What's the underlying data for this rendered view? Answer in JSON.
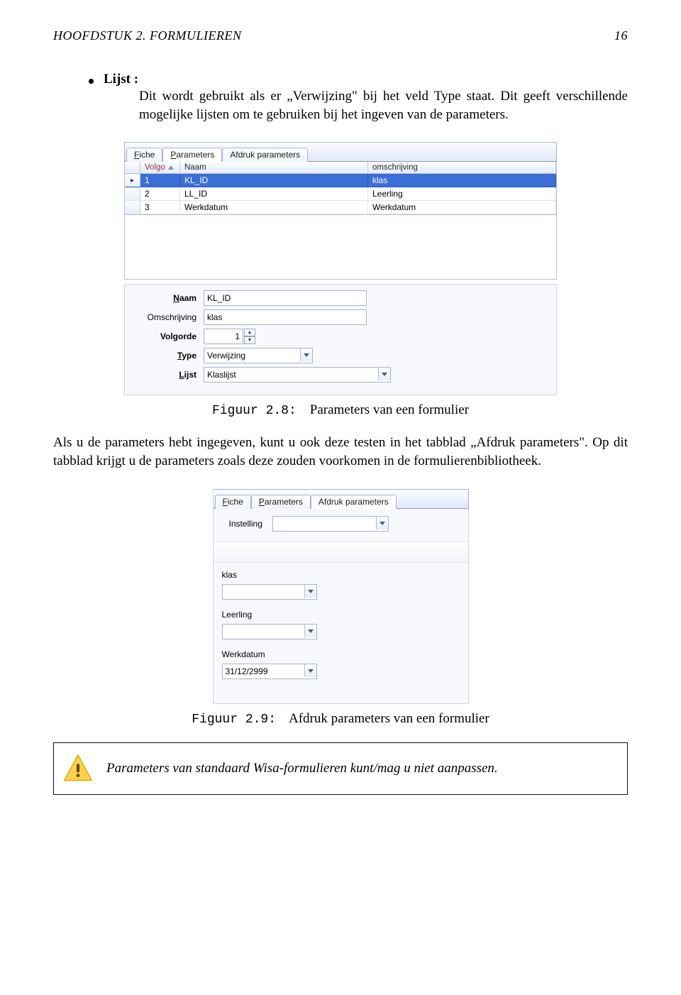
{
  "header": {
    "left": "HOOFDSTUK 2.  FORMULIEREN",
    "right": "16"
  },
  "bullet": {
    "label": "Lijst :",
    "body": "Dit wordt gebruikt als er „Verwijzing\" bij het veld Type staat. Dit geeft verschillende mogelijke lijsten om te gebruiken bij het ingeven van de parameters."
  },
  "figure1": {
    "tabs": {
      "fiche_pre": "F",
      "fiche": "iche",
      "params_pre": "P",
      "params": "arameters",
      "afdruk": "Afdruk parameters"
    },
    "columns": {
      "blank": "",
      "volg": "Volgo",
      "naam": "Naam",
      "omsch": "omschrijving"
    },
    "rows": [
      {
        "ind": "▸",
        "n": "1",
        "naam": "KL_ID",
        "om": "klas",
        "selected": true
      },
      {
        "ind": "",
        "n": "2",
        "naam": "LL_ID",
        "om": "Leerling",
        "selected": false
      },
      {
        "ind": "",
        "n": "3",
        "naam": "Werkdatum",
        "om": "Werkdatum",
        "selected": false
      }
    ],
    "form": {
      "naam_label_pre": "N",
      "naam_label": "aam",
      "naam_value": "KL_ID",
      "omschrijving_label": "Omschrijving",
      "omschrijving_value": "klas",
      "volgorde_label": "Volgorde",
      "volgorde_value": "1",
      "type_label_pre": "T",
      "type_label": "ype",
      "type_value": "Verwijzing",
      "lijst_label_pre": "L",
      "lijst_label": "ijst",
      "lijst_value": "Klaslijst"
    },
    "caption_tt": "Figuur 2.8:",
    "caption": "Parameters van een formulier"
  },
  "para2": "Als u de parameters hebt ingegeven, kunt u ook deze testen in het tabblad „Afdruk parameters\". Op dit tabblad krijgt u de parameters zoals deze zouden voorkomen in de formulierenbibliotheek.",
  "figure2": {
    "tabs": {
      "fiche_pre": "F",
      "fiche": "iche",
      "params_pre": "P",
      "params": "arameters",
      "afdruk": "Afdruk parameters"
    },
    "instelling_label": "Instelling",
    "klas_label": "klas",
    "leerling_label": "Leerling",
    "werkdatum_label": "Werkdatum",
    "werkdatum_value": "31/12/2999",
    "caption_tt": "Figuur 2.9:",
    "caption": "Afdruk parameters van een formulier"
  },
  "note": "Parameters van standaard Wisa-formulieren kunt/mag u niet aanpassen."
}
